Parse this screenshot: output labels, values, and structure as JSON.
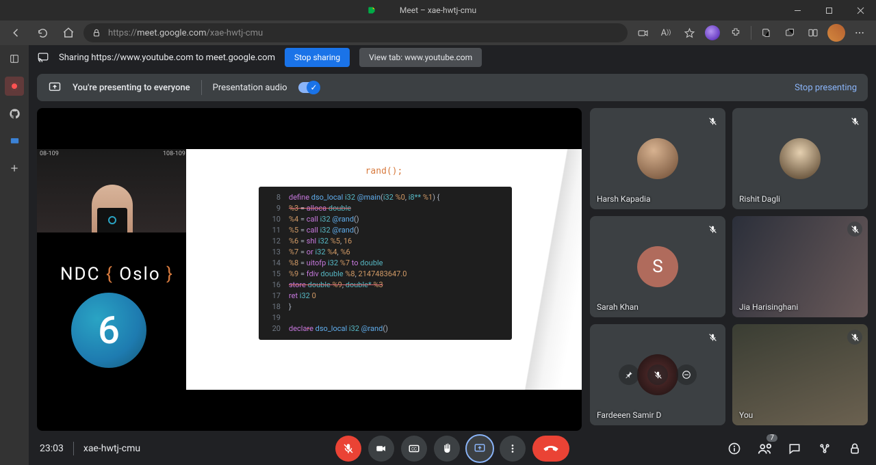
{
  "window": {
    "title": "Meet – xae-hwtj-cmu"
  },
  "browser": {
    "url_proto": "https://",
    "url_host": "meet.google.com",
    "url_path": "/xae-hwtj-cmu"
  },
  "share_bar": {
    "message": "Sharing https://www.youtube.com to meet.google.com",
    "stop_label": "Stop sharing",
    "view_label": "View tab: www.youtube.com"
  },
  "present_banner": {
    "text": "You're presenting to everyone",
    "audio_label": "Presentation audio",
    "audio_on": true,
    "stop_label": "Stop presenting"
  },
  "participants": [
    {
      "name": "Harsh Kapadia",
      "mic_muted": true,
      "avatar_kind": "photo1"
    },
    {
      "name": "Rishit Dagli",
      "mic_muted": true,
      "avatar_kind": "photo2"
    },
    {
      "name": "Sarah Khan",
      "mic_muted": true,
      "avatar_kind": "letter",
      "letter": "S"
    },
    {
      "name": "Jia Harisinghani",
      "mic_muted": true,
      "avatar_kind": "video1"
    },
    {
      "name": "Fardeeen Samir D",
      "mic_muted": true,
      "avatar_kind": "photo3",
      "pinned_overlay": true
    },
    {
      "name": "You",
      "mic_muted": true,
      "avatar_kind": "video2"
    }
  ],
  "presentation": {
    "yt_tag_left": "08-109",
    "yt_tag_right": "108-109",
    "ndc_text": "NDC",
    "ndc_brace_open": " { ",
    "ndc_city": "Oslo",
    "ndc_brace_close": " }",
    "circle_value": "6",
    "slide_heading": "rand();",
    "code_lines": [
      {
        "n": "8",
        "html": "<span class='kw'>define</span> <span class='id'>dso_local</span> <span class='ty'>i32</span> <span class='id'>@main</span>(<span class='ty'>i32</span> <span class='nm'>%0</span>, <span class='ty'>i8**</span> <span class='nm'>%1</span>) {"
      },
      {
        "n": "9",
        "html": "<span class='strike'>  <span class='nm'>%3</span> <span class='op'>=</span> <span class='kw'>alloca</span> <span class='ty'>double</span></span>"
      },
      {
        "n": "10",
        "html": "  <span class='nm'>%4</span> <span class='op'>=</span> <span class='kw'>call</span> <span class='ty'>i32</span> <span class='id'>@rand</span>()"
      },
      {
        "n": "11",
        "html": "  <span class='nm'>%5</span> <span class='op'>=</span> <span class='kw'>call</span> <span class='ty'>i32</span> <span class='id'>@rand</span>()"
      },
      {
        "n": "12",
        "html": "  <span class='nm'>%6</span> <span class='op'>=</span> <span class='kw'>shl</span> <span class='ty'>i32</span> <span class='nm'>%5</span>, <span class='nm'>16</span>"
      },
      {
        "n": "13",
        "html": "  <span class='nm'>%7</span> <span class='op'>=</span> <span class='kw'>or</span> <span class='ty'>i32</span> <span class='nm'>%4</span>, <span class='nm'>%6</span>"
      },
      {
        "n": "14",
        "html": "  <span class='nm'>%8</span> <span class='op'>=</span> <span class='kw'>uitofp</span> <span class='ty'>i32</span> <span class='nm'>%7</span> <span class='kw'>to</span> <span class='ty'>double</span>"
      },
      {
        "n": "15",
        "html": "  <span class='nm'>%9</span> <span class='op'>=</span> <span class='kw'>fdiv</span> <span class='ty'>double</span> <span class='nm'>%8</span>, <span class='nm'>2147483647.0</span>"
      },
      {
        "n": "16",
        "html": "<span class='strike'>  <span class='kw'>store</span> <span class='ty'>double</span> <span class='nm'>%9</span>, <span class='ty'>double*</span> <span class='nm'>%3</span></span>"
      },
      {
        "n": "17",
        "html": "  <span class='kw'>ret</span> <span class='ty'>i32</span> <span class='nm'>0</span>"
      },
      {
        "n": "18",
        "html": "}"
      },
      {
        "n": "19",
        "html": "&nbsp;"
      },
      {
        "n": "20",
        "html": "<span class='kw'>decla<span class='strike'>r</span>e</span> <span class='id'>dso_local</span> <span class='ty'>i32</span> <span class='id'>@rand</span>()"
      }
    ]
  },
  "bottom": {
    "time": "23:03",
    "meeting_id": "xae-hwtj-cmu",
    "participant_count": "7"
  }
}
